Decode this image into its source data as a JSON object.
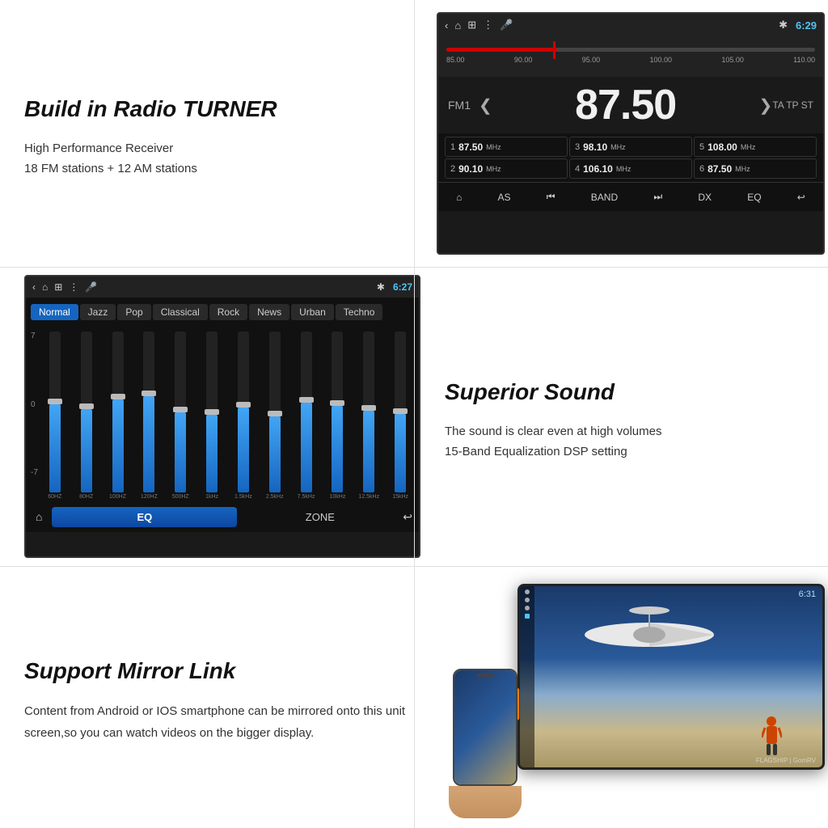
{
  "sections": {
    "radio": {
      "title": "Build in Radio TURNER",
      "features": [
        "High Performance Receiver",
        "18 FM stations + 12 AM stations"
      ],
      "screen": {
        "time": "6:29",
        "fm_label": "FM1",
        "frequency": "87.50",
        "tuner_marks": [
          "85.00",
          "90.00",
          "95.00",
          "100.00",
          "105.00",
          "110.00"
        ],
        "presets": [
          {
            "num": "1",
            "freq": "87.50",
            "unit": "MHz"
          },
          {
            "num": "3",
            "freq": "98.10",
            "unit": "MHz"
          },
          {
            "num": "5",
            "freq": "108.00",
            "unit": "MHz"
          },
          {
            "num": "2",
            "freq": "90.10",
            "unit": "MHz"
          },
          {
            "num": "4",
            "freq": "106.10",
            "unit": "MHz"
          },
          {
            "num": "6",
            "freq": "87.50",
            "unit": "MHz"
          }
        ],
        "bottom_buttons": [
          "AS",
          "◀",
          "BAND",
          "▶",
          "DX",
          "EQ"
        ]
      }
    },
    "equalizer": {
      "screen": {
        "time": "6:27",
        "modes": [
          "Normal",
          "Jazz",
          "Pop",
          "Classical",
          "Rock",
          "News",
          "Urban",
          "Techno"
        ],
        "active_mode": "Normal",
        "level_labels": [
          "7",
          "0",
          "-7"
        ],
        "bands": [
          {
            "label": "60HZ",
            "fill_pct": 55
          },
          {
            "label": "80HZ",
            "fill_pct": 52
          },
          {
            "label": "100HZ",
            "fill_pct": 58
          },
          {
            "label": "120HZ",
            "fill_pct": 60
          },
          {
            "label": "500HZ",
            "fill_pct": 50
          },
          {
            "label": "1kHz",
            "fill_pct": 48
          },
          {
            "label": "1.5kHz",
            "fill_pct": 53
          },
          {
            "label": "2.5kHz",
            "fill_pct": 47
          },
          {
            "label": "7.5kHz",
            "fill_pct": 56
          },
          {
            "label": "10kHz",
            "fill_pct": 54
          },
          {
            "label": "12.5kHz",
            "fill_pct": 51
          },
          {
            "label": "15kHz",
            "fill_pct": 49
          }
        ],
        "bottom_buttons": {
          "home": "⌂",
          "eq": "EQ",
          "zone": "ZONE"
        }
      }
    },
    "sound": {
      "title": "Superior Sound",
      "features": [
        "The sound is clear even at high volumes",
        "15-Band Equalization DSP setting"
      ]
    },
    "mirror": {
      "title": "Support Mirror Link",
      "description": "Content from Android or IOS smartphone can be mirrored onto this unit screen,so you can watch videos on the  bigger display.",
      "screen": {
        "time": "6:31",
        "watermark": "FLAGSHIP | GomRV"
      }
    }
  }
}
